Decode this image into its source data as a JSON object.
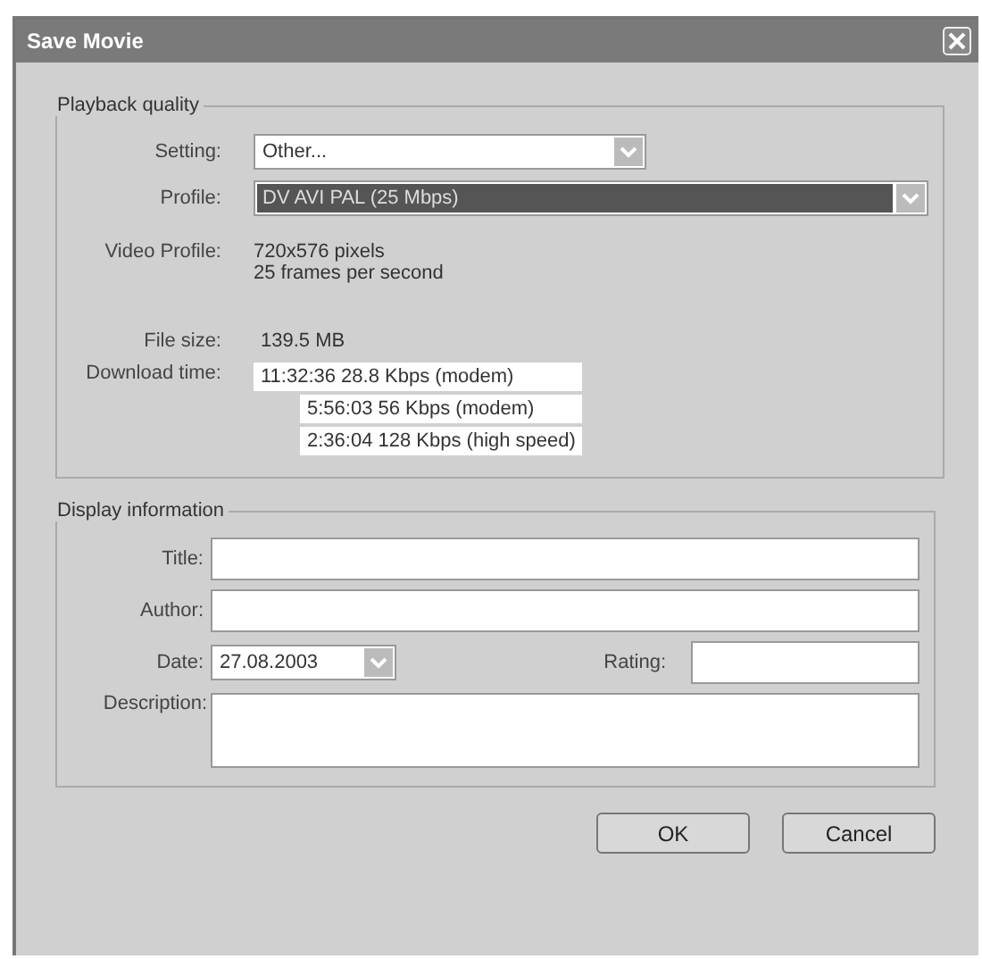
{
  "window": {
    "title": "Save Movie"
  },
  "playback_quality": {
    "legend": "Playback quality",
    "setting": {
      "label": "Setting:",
      "value": "Other..."
    },
    "profile": {
      "label": "Profile:",
      "value": "DV AVI PAL (25 Mbps)",
      "selected": true
    },
    "video_profile": {
      "label": "Video Profile:",
      "lines": [
        "720x576 pixels",
        "25 frames per second"
      ]
    },
    "file_size": {
      "label": "File size:",
      "value": "139.5 MB"
    },
    "download_time": {
      "label": "Download time:",
      "lines": [
        "11:32:36  28.8 Kbps (modem)",
        "5:56:03  56 Kbps (modem)",
        "2:36:04  128 Kbps (high speed)"
      ]
    }
  },
  "display_information": {
    "legend": "Display information",
    "title": {
      "label": "Title:"
    },
    "author": {
      "label": "Author:"
    },
    "date": {
      "label": "Date:",
      "value": "27.08.2003"
    },
    "rating": {
      "label": "Rating:"
    },
    "description": {
      "label": "Description:"
    }
  },
  "buttons": [
    "OK",
    "Cancel"
  ]
}
